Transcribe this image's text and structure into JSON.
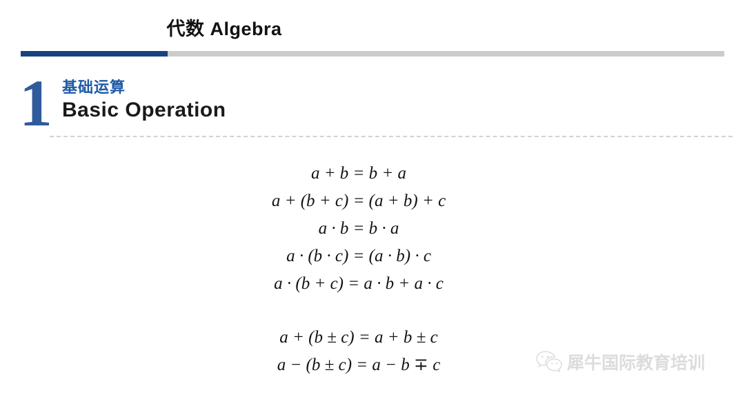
{
  "slide": {
    "title": "代数 Algebra",
    "accent_blue": "#17427e",
    "track_gray": "#cccccc",
    "number_blue": "#2f5b9c",
    "heading_blue": "#1f5aa6"
  },
  "progress": {
    "percent": 21
  },
  "section": {
    "number": "1",
    "title_cn": "基础运算",
    "title_en": "Basic Operation"
  },
  "equations": {
    "group1": [
      "a + b = b + a",
      "a + (b + c) = (a + b) + c",
      "a · b = b · a",
      "a · (b · c) = (a · b) · c",
      "a · (b + c) = a · b + a · c"
    ],
    "group2": [
      "a + (b ± c) = a + b ± c",
      "a − (b ± c) = a − b ∓ c"
    ]
  },
  "watermark": {
    "icon": "wechat-icon",
    "text": "犀牛国际教育培训",
    "color": "#d6d6d6"
  }
}
